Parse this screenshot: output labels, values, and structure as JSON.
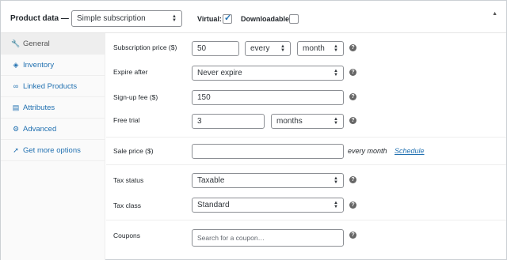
{
  "header": {
    "title": "Product data —",
    "product_type": "Simple subscription",
    "virtual_label": "Virtual:",
    "virtual_checked": true,
    "downloadable_label": "Downloadable:",
    "downloadable_checked": false
  },
  "tabs": [
    {
      "label": "General",
      "icon": "wrench-icon",
      "active": true
    },
    {
      "label": "Inventory",
      "icon": "tag-icon",
      "active": false
    },
    {
      "label": "Linked Products",
      "icon": "link-icon",
      "active": false
    },
    {
      "label": "Attributes",
      "icon": "list-icon",
      "active": false
    },
    {
      "label": "Advanced",
      "icon": "gear-icon",
      "active": false
    },
    {
      "label": "Get more options",
      "icon": "plugin-icon",
      "active": false
    }
  ],
  "fields": {
    "subscription_price": {
      "label": "Subscription price ($)",
      "value": "50",
      "interval": "every",
      "period": "month"
    },
    "expire_after": {
      "label": "Expire after",
      "value": "Never expire"
    },
    "signup_fee": {
      "label": "Sign-up fee ($)",
      "value": "150"
    },
    "free_trial": {
      "label": "Free trial",
      "value": "3",
      "period": "months"
    },
    "sale_price": {
      "label": "Sale price ($)",
      "value": "",
      "note": "every month",
      "schedule_link": "Schedule"
    },
    "tax_status": {
      "label": "Tax status",
      "value": "Taxable"
    },
    "tax_class": {
      "label": "Tax class",
      "value": "Standard"
    },
    "coupons": {
      "label": "Coupons",
      "placeholder": "Search for a coupon…"
    }
  },
  "help_glyph": "?",
  "colors": {
    "link": "#2271b1",
    "text": "#23282d",
    "border": "#8c8f94"
  }
}
